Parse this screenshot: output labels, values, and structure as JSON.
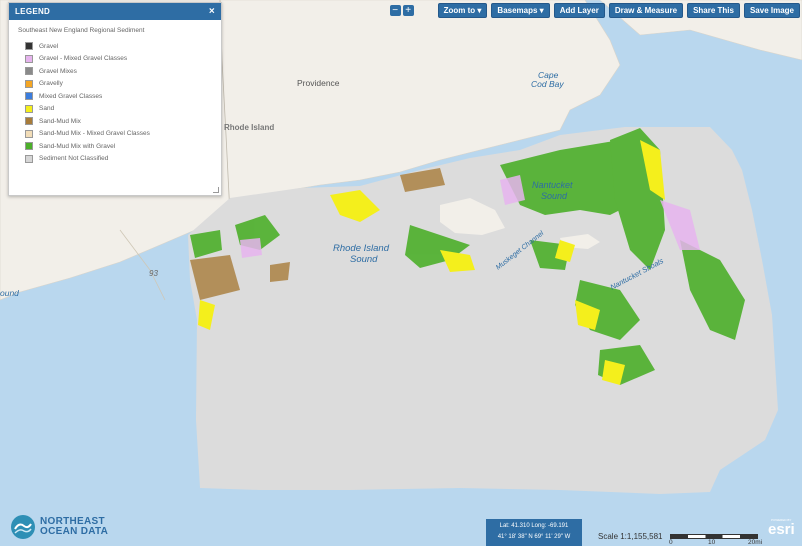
{
  "toolbar": {
    "zoom_out": "−",
    "zoom_in": "+",
    "zoom_to": "Zoom to ▾",
    "basemaps": "Basemaps ▾",
    "add_layer": "Add Layer",
    "draw_measure": "Draw & Measure",
    "share": "Share This",
    "save_image": "Save Image"
  },
  "legend": {
    "title": "LEGEND",
    "close": "×",
    "subtitle": "Southeast New England Regional Sediment",
    "items": [
      {
        "label": "Gravel",
        "color": "#333333"
      },
      {
        "label": "Gravel - Mixed Gravel Classes",
        "color": "#e6b4ee"
      },
      {
        "label": "Gravel Mixes",
        "color": "#8a8a8a"
      },
      {
        "label": "Gravelly",
        "color": "#f5a623"
      },
      {
        "label": "Mixed Gravel Classes",
        "color": "#3b7ddd"
      },
      {
        "label": "Sand",
        "color": "#f4ef1c"
      },
      {
        "label": "Sand-Mud Mix",
        "color": "#a87c3a"
      },
      {
        "label": "Sand-Mud Mix - Mixed Gravel Classes",
        "color": "#f2ddb8"
      },
      {
        "label": "Sand-Mud Mix with Gravel",
        "color": "#4caf2a"
      },
      {
        "label": "Sediment Not Classified",
        "color": "#d6d6d6"
      }
    ]
  },
  "map_labels": {
    "providence": "Providence",
    "rhode_island": "Rhode Island",
    "cape_cod_bay_1": "Cape",
    "cape_cod_bay_2": "Cod Bay",
    "nantucket_sound_1": "Nantucket",
    "nantucket_sound_2": "Sound",
    "ri_sound_1": "Rhode Island",
    "ri_sound_2": "Sound",
    "muskeget": "Muskeget Channel",
    "nantucket_shoals": "Nantucket Shoals",
    "route": "93",
    "sound_left": "ound"
  },
  "brand": {
    "line1": "NORTHEAST",
    "line2": "OCEAN DATA"
  },
  "coords": {
    "line1": "Lat: 41.310  Long: -69.191",
    "line2": "41° 18' 38\" N  69° 11' 29\" W"
  },
  "scale": {
    "label": "Scale 1:1,155,581",
    "t0": "0",
    "t1": "10",
    "t2": "20mi"
  },
  "esri": {
    "powered": "POWERED BY",
    "text": "esri"
  }
}
